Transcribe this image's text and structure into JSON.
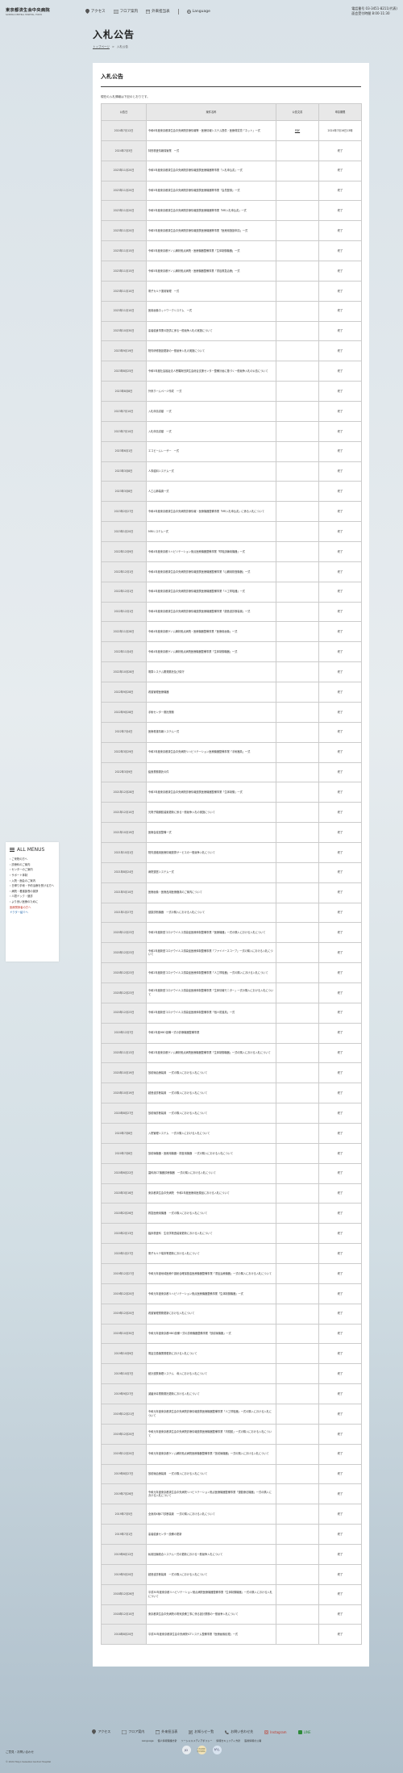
{
  "header": {
    "logo_main": "東京都済生会中央病院",
    "logo_sub": "SAISEIKAI CENTRAL HOSPITAL, TOKYO",
    "nav": [
      {
        "label": "アクセス",
        "icon": "pin-icon"
      },
      {
        "label": "フロア案内",
        "icon": "map-icon"
      },
      {
        "label": "外来担当表",
        "icon": "calendar-icon"
      },
      {
        "label": "Language",
        "icon": "globe-icon"
      }
    ],
    "tel_label": "電話番号",
    "tel": "03-3451-8211(代表)",
    "hours_label": "面会受付時間",
    "hours": "8:00-11:30"
  },
  "page": {
    "title": "入札公告",
    "breadcrumb_home": "トップページ",
    "breadcrumb_sep": ">",
    "breadcrumb_current": "入札公告"
  },
  "main": {
    "section_title": "入札公告",
    "intro": "現在の入札情報は下記のとおりです。",
    "headers": [
      "公告日",
      "案件名称",
      "公告文書",
      "申請期限"
    ],
    "rows": [
      {
        "date": "2024年7月12日",
        "name": "令和6年度東京都済生会中央病院診療情報等・医療情報システム提供・医療費賃貸「ネット」一式",
        "pdf": "PDF",
        "status": "2024年7月16日13時"
      },
      {
        "date": "2024年7月3日",
        "name": "特別検査情報保管業　一式",
        "pdf": "",
        "status": "終了"
      },
      {
        "date": "2023年11月20日",
        "name": "令和5年度東京都済生会中央病院診療情報連携医療機器等事業「入札申込書」一式",
        "pdf": "",
        "status": "終了"
      },
      {
        "date": "2023年11月20日",
        "name": "令和5年度東京都済生会中央病院診療情報連携医療機器等事業「会員登録」一式",
        "pdf": "",
        "status": "終了"
      },
      {
        "date": "2023年11月20日",
        "name": "令和5年度東京都済生会中央病院診療情報連携医療機器等事業「MR入札申込書」一式",
        "pdf": "",
        "status": "終了"
      },
      {
        "date": "2023年11月20日",
        "name": "令和5年度東京都済生会中央病院診療情報連携医療機器等事業「医療用施設申請」一式",
        "pdf": "",
        "status": "終了"
      },
      {
        "date": "2023年11月15日",
        "name": "令和5年度東京都ゲノム解析拠点病院・医療機器整備事業「生体制御機器」一式",
        "pdf": "",
        "status": "終了"
      },
      {
        "date": "2023年11月15日",
        "name": "令和5年度東京都ゲノム解析拠点病院・医療機器整備事業「重症救急治療」一式",
        "pdf": "",
        "status": "終了"
      },
      {
        "date": "2023年11月10日",
        "name": "電子カルテ運用管理　一式",
        "pdf": "",
        "status": "終了"
      },
      {
        "date": "2023年11月10日",
        "name": "医用画像ネットワークシステム　一式",
        "pdf": "",
        "status": "終了"
      },
      {
        "date": "2023年10月30日",
        "name": "患者給食事業の提供に係る一般競争入札の実施について",
        "pdf": "",
        "status": "終了"
      },
      {
        "date": "2023年9月19日",
        "name": "院内研修施設更新の一般競争入札の実施について",
        "pdf": "",
        "status": "終了"
      },
      {
        "date": "2023年8月25日",
        "name": "令和5年度社会福祉法人恩賜財団済生会総合支援センター整備計画に基づく一般競争入札の公告について",
        "pdf": "",
        "status": "終了"
      },
      {
        "date": "2023年8月8日",
        "name": "外来ホームページ作成　一式",
        "pdf": "",
        "status": "終了"
      },
      {
        "date": "2023年7月10日",
        "name": "入札申請書類　一式",
        "pdf": "",
        "status": "終了"
      },
      {
        "date": "2023年7月10日",
        "name": "入札申請書類　一式",
        "pdf": "",
        "status": "終了"
      },
      {
        "date": "2023年6月1日",
        "name": "エコビームレーザー　一式",
        "pdf": "",
        "status": "終了"
      },
      {
        "date": "2023年3月8日",
        "name": "人事給料システム一式",
        "pdf": "",
        "status": "終了"
      },
      {
        "date": "2023年3月8日",
        "name": "人工心肺装置一式",
        "pdf": "",
        "status": "終了"
      },
      {
        "date": "2023年2月27日",
        "name": "令和4年度東京都済生会中央病院診療情報・医療機器整備事業「MR入札申込書」に係る入札について",
        "pdf": "",
        "status": "終了"
      },
      {
        "date": "2023年1月20日",
        "name": "MRIシステム一式",
        "pdf": "",
        "status": "終了"
      },
      {
        "date": "2022年12月9日",
        "name": "令和4年度東京都リハビリテーション拠点医療機器整備事業「呼吸訓練用機器」一式",
        "pdf": "",
        "status": "終了"
      },
      {
        "date": "2022年12月1日",
        "name": "令和4年度東京都済生会中央病院診療情報連携医療機器整備事業「心臓用検査機器」一式",
        "pdf": "",
        "status": "終了"
      },
      {
        "date": "2022年12月1日",
        "name": "令和4年度東京都済生会中央病院診療情報連携医療機器整備事業「人工呼吸器」一式",
        "pdf": "",
        "status": "終了"
      },
      {
        "date": "2022年12月1日",
        "name": "令和4年度東京都済生会中央病院診療情報連携医療機器整備事業「超音波診断装置」一式",
        "pdf": "",
        "status": "終了"
      },
      {
        "date": "2022年11月28日",
        "name": "令和4年度東京都ゲノム解析拠点病院・医療機器整備事業「医療用画像」一式",
        "pdf": "",
        "status": "終了"
      },
      {
        "date": "2022年11月4日",
        "name": "令和4年度東京都ゲノム解析拠点病院医療機器整備事業「生体制御機器」一式",
        "pdf": "",
        "status": "終了"
      },
      {
        "date": "2022年10月28日",
        "name": "電算システム開発委託及び保守",
        "pdf": "",
        "status": "終了"
      },
      {
        "date": "2022年9月28日",
        "name": "看護管理医療機器",
        "pdf": "",
        "status": "終了"
      },
      {
        "date": "2022年9月28日",
        "name": "手術センター委託業務",
        "pdf": "",
        "status": "終了"
      },
      {
        "date": "2022年7月4日",
        "name": "医療看護情報システム一式",
        "pdf": "",
        "status": "終了"
      },
      {
        "date": "2022年3月29日",
        "name": "令和3年度東京都済生会中央病院リハビリテーション医療機器整備事業「手術器具」一式",
        "pdf": "",
        "status": "終了"
      },
      {
        "date": "2022年3月9日",
        "name": "給食業務委託の件",
        "pdf": "",
        "status": "終了"
      },
      {
        "date": "2021年12月28日",
        "name": "令和3年度東京都済生会中央病院診療情報連携医療機器整備事業「生体制御」一式",
        "pdf": "",
        "status": "終了"
      },
      {
        "date": "2021年12月10日",
        "name": "光電子顕微鏡装置更新に係る一般競争入札の実施について",
        "pdf": "",
        "status": "終了"
      },
      {
        "date": "2021年10月19日",
        "name": "医療会議室整備一式",
        "pdf": "",
        "status": "終了"
      },
      {
        "date": "2021年10月1日",
        "name": "院内連絡用医療情報連携サービスの一般競争入札について",
        "pdf": "",
        "status": "終了"
      },
      {
        "date": "2021年8月24日",
        "name": "病院運営システム一式",
        "pdf": "",
        "status": "終了"
      },
      {
        "date": "2021年5月10日",
        "name": "医療画像・医療品用医療器具のご案内について",
        "pdf": "",
        "status": "終了"
      },
      {
        "date": "2021年1月27日",
        "name": "健康診断機器　一式の購入における入札について",
        "pdf": "",
        "status": "終了"
      },
      {
        "date": "2020年12月23日",
        "name": "令和2年度新型コロナウイルス感染症医療体制整備事業「医療機器」一式の購入における入札について",
        "pdf": "",
        "status": "終了"
      },
      {
        "date": "2020年12月23日",
        "name": "令和2年度新型コロナウイルス感染症医療体制整備事業「ファイバースコープ」一式の購入における入札について",
        "pdf": "",
        "status": "終了"
      },
      {
        "date": "2020年12月23日",
        "name": "令和2年度新型コロナウイルス感染症医療体制整備事業「人工呼吸器」一式の購入における入札について",
        "pdf": "",
        "status": "終了"
      },
      {
        "date": "2020年12月23日",
        "name": "令和2年度新型コロナウイルス感染症医療体制整備事業「生体情報モニター」一式の購入における入札について",
        "pdf": "",
        "status": "終了"
      },
      {
        "date": "2020年12月23日",
        "name": "令和2年度新型コロナウイルス感染症医療体制整備事業「個人防護具」一式",
        "pdf": "",
        "status": "終了"
      },
      {
        "date": "2020年12月7日",
        "name": "令和2年度HBO設備一式の診療機器整備事業",
        "pdf": "",
        "status": "終了"
      },
      {
        "date": "2020年11月13日",
        "name": "令和2年度東京都ゲノム解析拠点病院医療機器整備事業「生体制御機器」一式の購入における入札について",
        "pdf": "",
        "status": "終了"
      },
      {
        "date": "2020年10月19日",
        "name": "放射線治療装置　一式の購入における入札について",
        "pdf": "",
        "status": "終了"
      },
      {
        "date": "2020年10月19日",
        "name": "超音波診断装置　一式の購入における入札について",
        "pdf": "",
        "status": "終了"
      },
      {
        "date": "2020年8月27日",
        "name": "放射線診断装置　一式の購入における入札について",
        "pdf": "",
        "status": "終了"
      },
      {
        "date": "2020年7月8日",
        "name": "入院管理システム　一式の購入における入札について",
        "pdf": "",
        "status": "終了"
      },
      {
        "date": "2020年7月8日",
        "name": "放射線機器・医療用機器・検査用機器　一式の購入における入札について",
        "pdf": "",
        "status": "終了"
      },
      {
        "date": "2020年6月22日",
        "name": "歯科用CT機器診療機器　一式の購入における入札について",
        "pdf": "",
        "status": "終了"
      },
      {
        "date": "2020年3月16日",
        "name": "東京都済生会中央病院　令和2年度医療用医薬品における入札について",
        "pdf": "",
        "status": "終了"
      },
      {
        "date": "2020年2月26日",
        "name": "救急医療用機器　一式の購入における入札について",
        "pdf": "",
        "status": "終了"
      },
      {
        "date": "2020年2月13日",
        "name": "臨床検査科　生化学検査装置更新における入札について",
        "pdf": "",
        "status": "終了"
      },
      {
        "date": "2020年1月27日",
        "name": "電子カルテ端末等更新における入札について",
        "pdf": "",
        "status": "終了"
      },
      {
        "date": "2019年12月27日",
        "name": "令和元年度地域医療介護総合確保基金医療機器整備事業「重症治療機器」一式の購入における入札について",
        "pdf": "",
        "status": "終了"
      },
      {
        "date": "2019年12月20日",
        "name": "令和元年度東京都リハビリテーション拠点医療機器整備事業「生体制御機器」一式",
        "pdf": "",
        "status": "終了"
      },
      {
        "date": "2019年12月20日",
        "name": "看護管理業務更新における入札について",
        "pdf": "",
        "status": "終了"
      },
      {
        "date": "2019年10月30日",
        "name": "令和元年度東京都HBO設備一式の診療機器整備事業「放射線機器」一式",
        "pdf": "",
        "status": "終了"
      },
      {
        "date": "2019年10月9日",
        "name": "電話交換機業務更新における入札について",
        "pdf": "",
        "status": "終了"
      },
      {
        "date": "2019年10月7日",
        "name": "統計連携管理システム　導入における入札について",
        "pdf": "",
        "status": "終了"
      },
      {
        "date": "2019年9月27日",
        "name": "滅菌消毒業務委託更新における入札について",
        "pdf": "",
        "status": "終了"
      },
      {
        "date": "2019年12月21日",
        "name": "令和元年度東京都済生会中央病院診療情報連携医療機器整備事業「人工呼吸器」一式の購入における入札について",
        "pdf": "",
        "status": "終了"
      },
      {
        "date": "2019年12月20日",
        "name": "令和元年度東京都済生会中央病院診療情報連携医療機器整備事業「内視鏡」一式の購入における入札について",
        "pdf": "",
        "status": "終了"
      },
      {
        "date": "2019年12月20日",
        "name": "令和元年度東京都ゲノム解析拠点病院医療機器整備事業「放射線機器」一式の購入における入札について",
        "pdf": "",
        "status": "終了"
      },
      {
        "date": "2019年8月27日",
        "name": "放射線治療装置　一式の購入における入札について",
        "pdf": "",
        "status": "終了"
      },
      {
        "date": "2019年7月26日",
        "name": "令和元年度東京都済生会中央病院リハビリテーション拠点医療機器整備事業「運動療法機器」一式の購入における入札について",
        "pdf": "",
        "status": "終了"
      },
      {
        "date": "2019年7月5日",
        "name": "全身用X線CT診断装置　一式の購入における入札について",
        "pdf": "",
        "status": "終了"
      },
      {
        "date": "2019年7月1日",
        "name": "患者給食センター設備の更新",
        "pdf": "",
        "status": "終了"
      },
      {
        "date": "2019年6月12日",
        "name": "私用回線統合システム一式の更新における一般競争入札について",
        "pdf": "",
        "status": "終了"
      },
      {
        "date": "2019年5月20日",
        "name": "超音波診断装置　一式の購入における入札について",
        "pdf": "",
        "status": "終了"
      },
      {
        "date": "2018年12月26日",
        "name": "平成30年度東京都リハビリテーション拠点病院医療機器整備事業「生体制御機器」一式の購入における入札について",
        "pdf": "",
        "status": "終了"
      },
      {
        "date": "2018年12月10日",
        "name": "東京都済生会中央病院の電気設備工事に係る設計業務の一般競争入札について",
        "pdf": "",
        "status": "終了"
      },
      {
        "date": "2018年8月20日",
        "name": "平成30年度東京都済生会中央病院ICTシステム整備事業「医療画像処理」一式",
        "pdf": "",
        "status": "終了"
      }
    ]
  },
  "side_menu": {
    "title": "ALL MENUS",
    "items": [
      "ご来院の方へ",
      "診療科のご案内",
      "センターのご案内",
      "サポート体制",
      "入院・面会のご案内",
      "日帰り手術・予約治療を受ける方へ",
      "病院・看護部長の挨拶",
      "人間ドック・健診",
      "より良い医療のために"
    ],
    "red_item": "医療関係者の方へ",
    "blue_item": "ドクター紹介へ"
  },
  "footer": {
    "nav": [
      {
        "label": "アクセス",
        "icon": "pin-icon"
      },
      {
        "label": "フロア案内",
        "icon": "map-icon"
      },
      {
        "label": "外来担当表",
        "icon": "calendar-icon"
      },
      {
        "label": "お知らせ一覧",
        "icon": "news-icon"
      },
      {
        "label": "お問い合わせ先",
        "icon": "phone-icon"
      },
      {
        "label": "Instagram",
        "icon": "instagram-icon"
      },
      {
        "label": "LINE",
        "icon": "line-icon"
      }
    ],
    "links": [
      "Language",
      "個人情報保護方針",
      "ソーシャルメディアポリシー",
      "情報セキュリティ方針",
      "医療情報の公開"
    ],
    "badges": [
      "JCI",
      "日本医療機能評価機構",
      "がん"
    ],
    "contact_link": "ご意見・お問い合わせ",
    "copyright": "© 2024 Tokyo Saiseikai Central Hospital"
  },
  "colors": {
    "accent_red": "#c0392b",
    "accent_blue": "#2a6db0",
    "table_header": "#e8e8e8"
  }
}
